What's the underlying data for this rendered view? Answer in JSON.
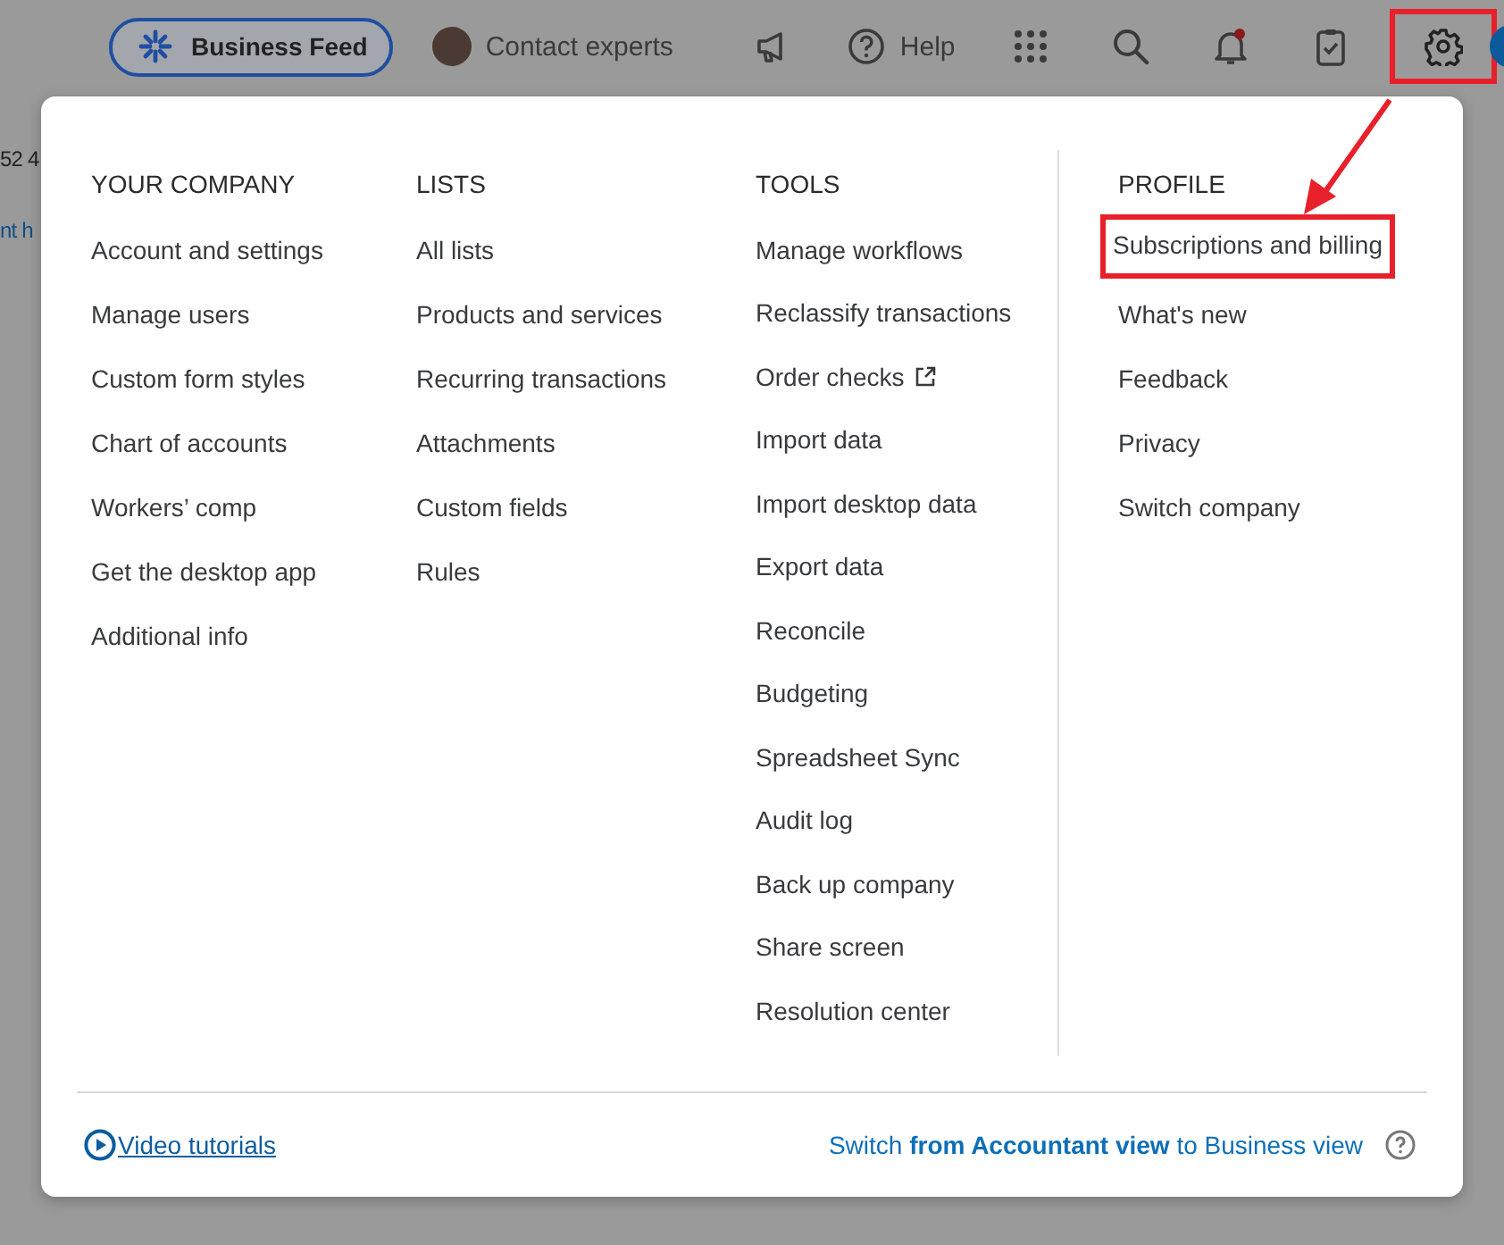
{
  "header": {
    "business_feed": "Business Feed",
    "contact": "Contact experts",
    "items": [
      {
        "kind": "megaphone",
        "highlighted": false
      },
      {
        "kind": "help",
        "label": "Help",
        "highlighted": false
      },
      {
        "kind": "apps",
        "highlighted": false
      },
      {
        "kind": "search",
        "highlighted": false
      },
      {
        "kind": "bell",
        "highlighted": false
      },
      {
        "kind": "clipboard",
        "highlighted": false
      },
      {
        "kind": "gear",
        "highlighted": true
      }
    ]
  },
  "background_texts": [
    {
      "text": "52 4",
      "kind": "plain"
    },
    {
      "text": "nt h",
      "kind": "link"
    }
  ],
  "menu": {
    "columns": [
      {
        "heading": "YOUR COMPANY",
        "items": [
          {
            "label": "Account and settings",
            "highlighted": false
          },
          {
            "label": "Manage users",
            "highlighted": false
          },
          {
            "label": "Custom form styles",
            "highlighted": false
          },
          {
            "label": "Chart of accounts",
            "highlighted": false
          },
          {
            "label": "Workers’ comp",
            "highlighted": false
          },
          {
            "label": "Get the desktop app",
            "highlighted": false
          },
          {
            "label": "Additional info",
            "highlighted": false
          }
        ]
      },
      {
        "heading": "LISTS",
        "items": [
          {
            "label": "All lists",
            "highlighted": false
          },
          {
            "label": "Products and services",
            "highlighted": false
          },
          {
            "label": "Recurring transactions",
            "highlighted": false
          },
          {
            "label": "Attachments",
            "highlighted": false
          },
          {
            "label": "Custom fields",
            "highlighted": false
          },
          {
            "label": "Rules",
            "highlighted": false
          }
        ]
      },
      {
        "heading": "TOOLS",
        "items": [
          {
            "label": "Manage workflows",
            "highlighted": false,
            "kind": "plain"
          },
          {
            "label": "Reclassify transactions",
            "highlighted": false,
            "kind": "plain"
          },
          {
            "label": "Order checks",
            "highlighted": false,
            "kind": "external"
          },
          {
            "label": "Import data",
            "highlighted": false,
            "kind": "plain"
          },
          {
            "label": "Import desktop data",
            "highlighted": false,
            "kind": "plain"
          },
          {
            "label": "Export data",
            "highlighted": false,
            "kind": "plain"
          },
          {
            "label": "Reconcile",
            "highlighted": false,
            "kind": "plain"
          },
          {
            "label": "Budgeting",
            "highlighted": false,
            "kind": "plain"
          },
          {
            "label": "Spreadsheet Sync",
            "highlighted": false,
            "kind": "plain"
          },
          {
            "label": "Audit log",
            "highlighted": false,
            "kind": "plain"
          },
          {
            "label": "Back up company",
            "highlighted": false,
            "kind": "plain"
          },
          {
            "label": "Share screen",
            "highlighted": false,
            "kind": "plain"
          },
          {
            "label": "Resolution center",
            "highlighted": false,
            "kind": "plain"
          }
        ]
      },
      {
        "heading": "PROFILE",
        "items": [
          {
            "label": "Subscriptions and billing",
            "highlighted": true
          },
          {
            "label": "What's new",
            "highlighted": false
          },
          {
            "label": "Feedback",
            "highlighted": false
          },
          {
            "label": "Privacy",
            "highlighted": false
          },
          {
            "label": "Switch company",
            "highlighted": false
          }
        ]
      }
    ],
    "footer": {
      "video_link": "Video tutorials",
      "switch_text": "Switch **from Accountant view** to Business view"
    }
  },
  "annotation": {
    "arrow": true
  }
}
